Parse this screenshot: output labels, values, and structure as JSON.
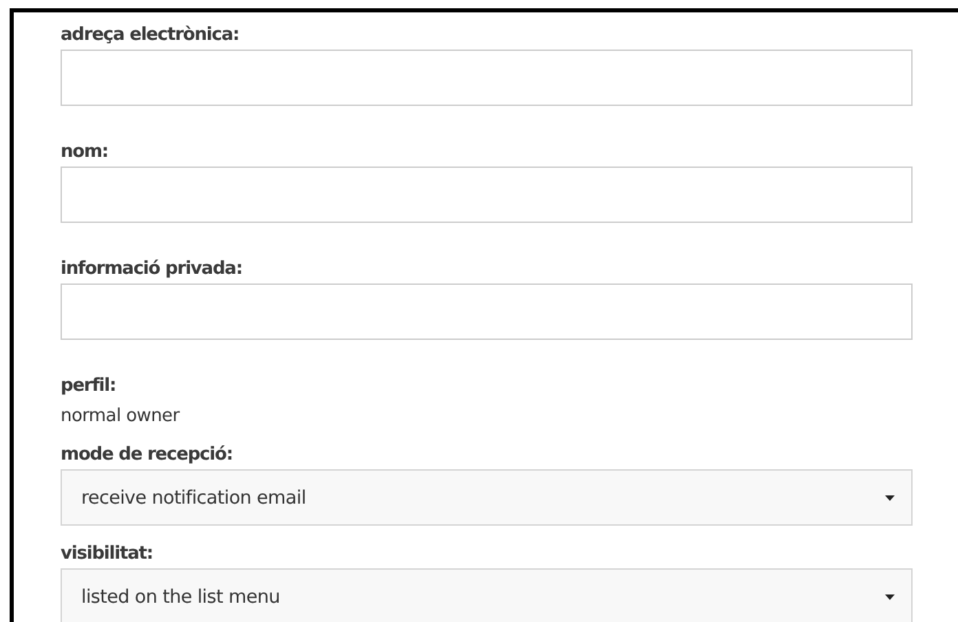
{
  "fields": [
    {
      "kind": "text",
      "label": "adreça electrònica:"
    },
    {
      "kind": "text",
      "label": "nom:"
    },
    {
      "kind": "text",
      "label": "informació privada:"
    },
    {
      "kind": "static",
      "label": "perfil:",
      "value": "normal owner"
    },
    {
      "kind": "select",
      "label": "mode de recepció:",
      "value": "receive notification email"
    },
    {
      "kind": "select",
      "label": "visibilitat:",
      "value": "listed on the list menu"
    }
  ]
}
